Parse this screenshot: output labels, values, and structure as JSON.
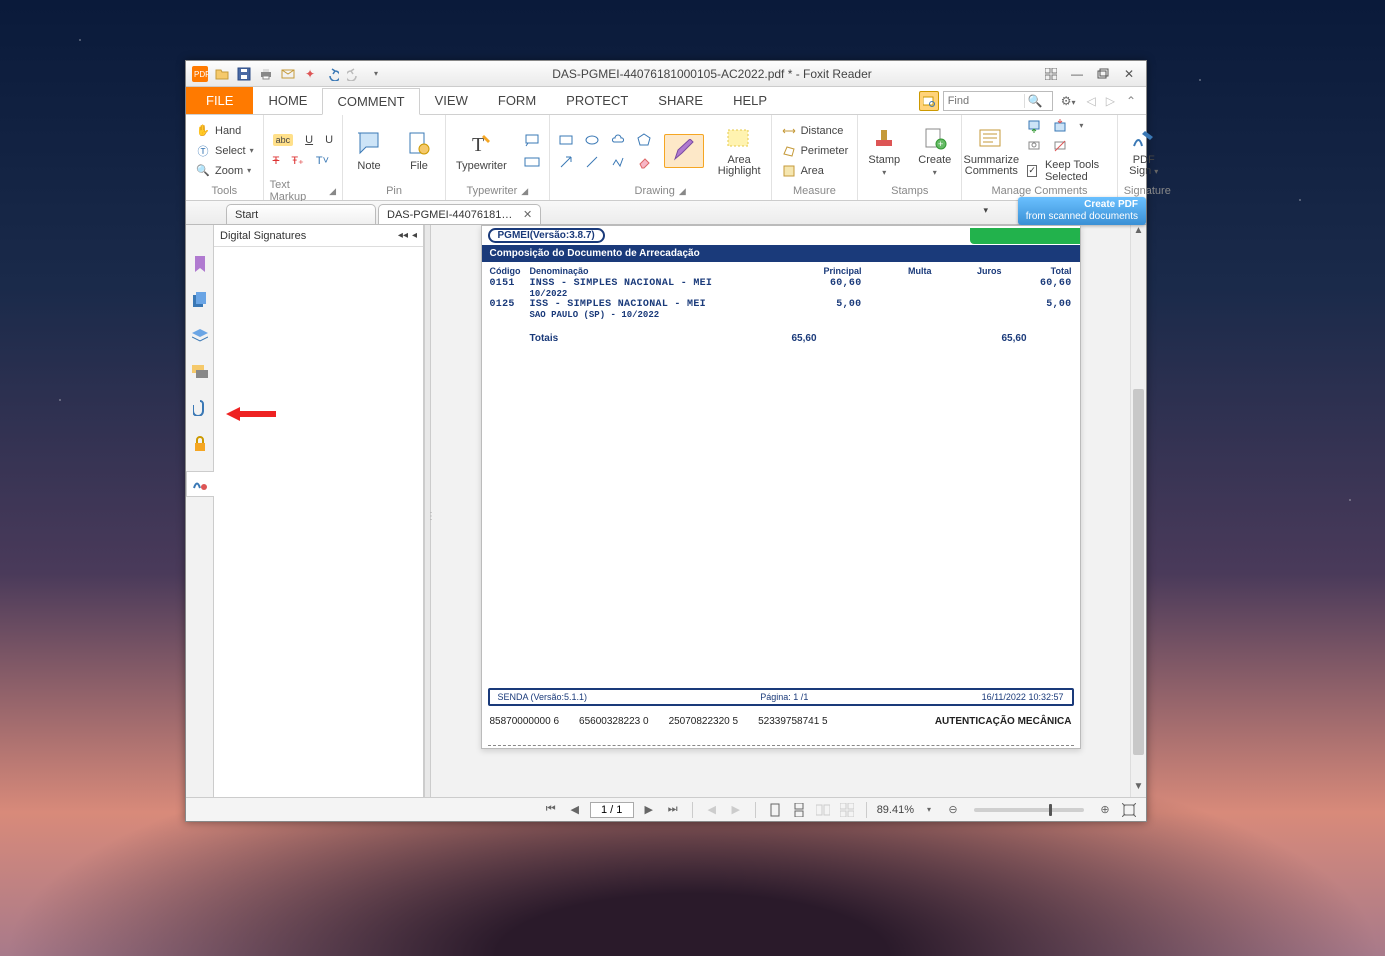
{
  "window_title": "DAS-PGMEI-44076181000105-AC2022.pdf * - Foxit Reader",
  "file_tab": "FILE",
  "ribbon_tabs": [
    "HOME",
    "COMMENT",
    "VIEW",
    "FORM",
    "PROTECT",
    "SHARE",
    "HELP"
  ],
  "active_ribbon_tab": "COMMENT",
  "find_placeholder": "Find",
  "ribbon_groups": {
    "tools": {
      "label": "Tools",
      "hand": "Hand",
      "select": "Select",
      "zoom": "Zoom"
    },
    "text_markup": {
      "label": "Text Markup"
    },
    "pin": {
      "label": "Pin",
      "note": "Note",
      "file": "File"
    },
    "typewriter": {
      "label": "Typewriter",
      "typewriter_btn": "Typewriter"
    },
    "drawing": {
      "label": "Drawing",
      "area_highlight": "Area\nHighlight"
    },
    "measure": {
      "label": "Measure",
      "distance": "Distance",
      "perimeter": "Perimeter",
      "area": "Area"
    },
    "stamps": {
      "label": "Stamps",
      "stamp": "Stamp",
      "create": "Create"
    },
    "manage_comments": {
      "label": "Manage Comments",
      "summarize": "Summarize\nComments",
      "keep_tools": "Keep Tools Selected"
    },
    "signature": {
      "label": "Signature",
      "pdf_sign": "PDF\nSign"
    }
  },
  "doc_tabs": {
    "start": "Start",
    "active": "DAS-PGMEI-44076181000..."
  },
  "promo": {
    "line1": "Create PDF",
    "line2": "from scanned documents"
  },
  "side_pane_title": "Digital Signatures",
  "document": {
    "pgm_version": "PGMEI(Versão:3.8.7)",
    "comp_header": "Composição do Documento de Arrecadação",
    "columns": {
      "codigo": "Código",
      "denom": "Denominação",
      "principal": "Principal",
      "multa": "Multa",
      "juros": "Juros",
      "total": "Total"
    },
    "rows": [
      {
        "codigo": "0151",
        "denom": "INSS - SIMPLES NACIONAL - MEI",
        "sub": "10/2022",
        "principal": "60,60",
        "multa": "",
        "juros": "",
        "total": "60,60"
      },
      {
        "codigo": "0125",
        "denom": "ISS - SIMPLES NACIONAL - MEI",
        "sub": "SAO PAULO (SP) - 10/2022",
        "principal": "5,00",
        "multa": "",
        "juros": "",
        "total": "5,00"
      }
    ],
    "totais_label": "Totais",
    "totais": {
      "principal": "65,60",
      "total": "65,60"
    },
    "footer_senda": "SENDA (Versão:5.1.1)",
    "footer_pagina": "Página:   1 /1",
    "footer_date": "16/11/2022 10:32:57",
    "auth_numbers": [
      "85870000000 6",
      "65600328223 0",
      "25070822320 5",
      "52339758741 5"
    ],
    "auth_label": "AUTENTICAÇÃO MECÂNICA"
  },
  "status": {
    "page_display": "1 / 1",
    "zoom_pct": "89.41%"
  }
}
